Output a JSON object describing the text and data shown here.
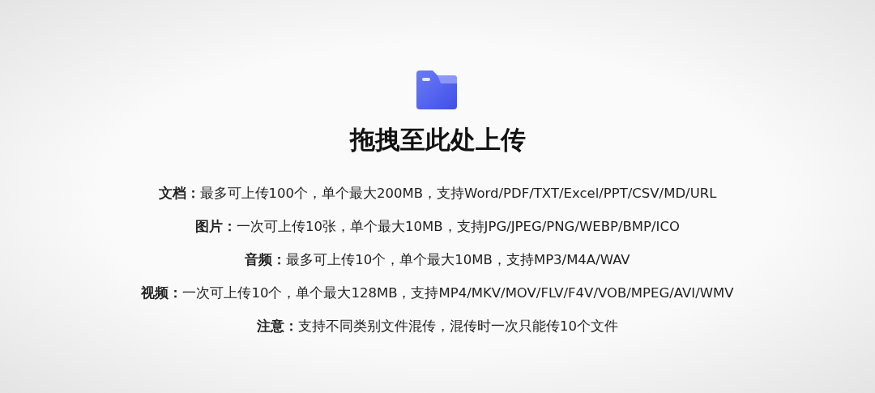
{
  "title": "拖拽至此处上传",
  "rules": [
    {
      "text": "**文档：**最多可上传100个，单个最大200MB，支持Word/PDF/TXT/Excel/PPT/CSV/MD/URL"
    },
    {
      "text": "**图片：**一次可上传10张，单个最大10MB，支持JPG/JPEG/PNG/WEBP/BMP/ICO"
    },
    {
      "text": "**音频：**最多可上传10个，单个最大10MB，支持MP3/M4A/WAV"
    },
    {
      "text": "**视频：**一次可上传10个，单个最大128MB，支持MP4/MKV/MOV/FLV/F4V/VOB/MPEG/AVI/WMV"
    },
    {
      "text": "**注意：**支持不同类别文件混传，混传时一次只能传10个文件"
    }
  ]
}
